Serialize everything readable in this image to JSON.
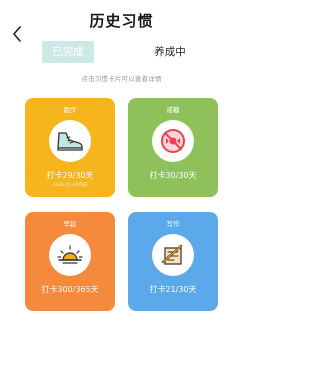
{
  "header": {
    "title": "历史习惯",
    "back_icon": "chevron-left-icon"
  },
  "tabs": [
    {
      "label": "已完成",
      "active": true
    },
    {
      "label": "养成中",
      "active": false
    }
  ],
  "hint": "点击习惯卡片可以查看详情",
  "colors": {
    "run": "#f6b51d",
    "quit": "#8fc15a",
    "early": "#f58a3c",
    "write": "#5ba9ea",
    "tab_active": "#cde9e5"
  },
  "cards": [
    {
      "title": "跑步",
      "icon": "sneaker-icon",
      "progress": "打卡29/30天",
      "date": "2020.05.08完成"
    },
    {
      "title": "戒糖",
      "icon": "no-candy-icon",
      "progress": "打卡30/30天",
      "date": ""
    },
    {
      "title": "早起",
      "icon": "sunrise-icon",
      "progress": "打卡300/365天",
      "date": ""
    },
    {
      "title": "写作",
      "icon": "writing-icon",
      "progress": "打卡21/30天",
      "date": ""
    }
  ]
}
